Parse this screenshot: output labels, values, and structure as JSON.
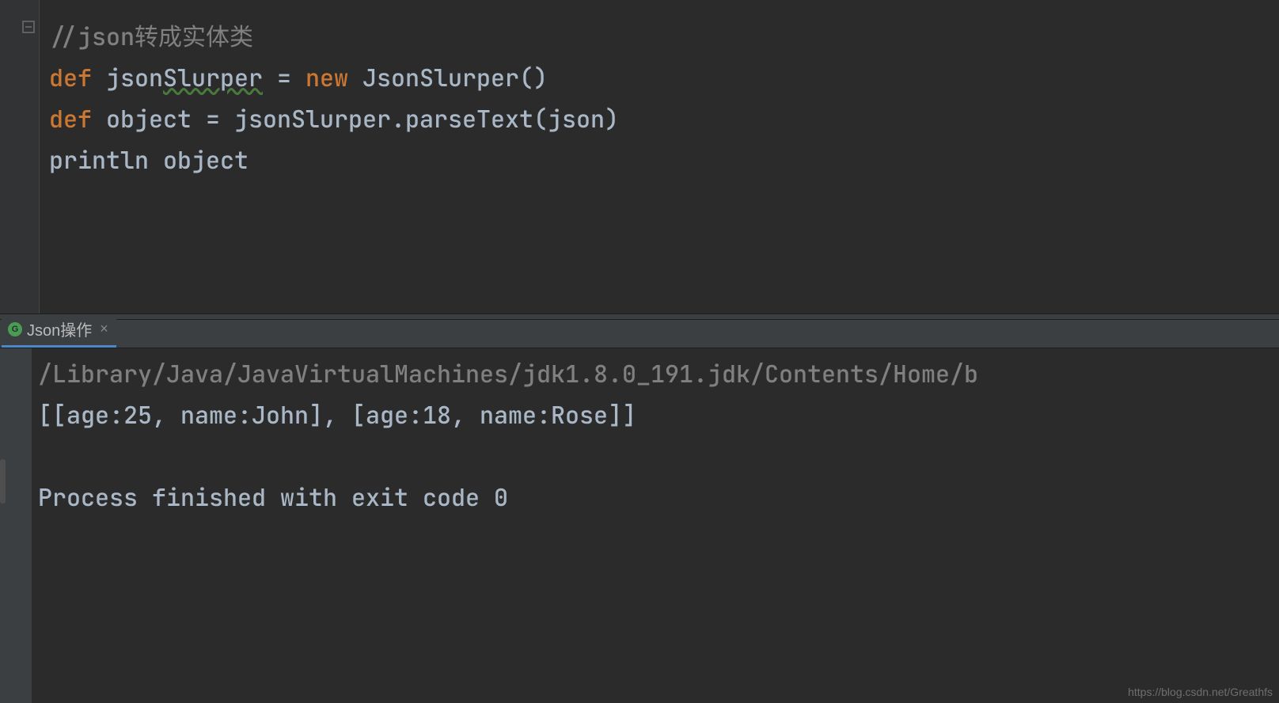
{
  "editor": {
    "comment": "//json转成实体类",
    "line2_def": "def",
    "line2_var": "json",
    "line2_slurper": "Slurper",
    "line2_eq": " = ",
    "line2_new": "new",
    "line2_call": " JsonSlurper()",
    "line3_def": "def",
    "line3_rest": " object = jsonSlurper.parseText(json)",
    "line4": "println object"
  },
  "tab": {
    "icon_letter": "G",
    "label": "Json操作",
    "close": "×"
  },
  "console": {
    "path": "/Library/Java/JavaVirtualMachines/jdk1.8.0_191.jdk/Contents/Home/b",
    "output_line": "[[age:25, name:John], [age:18, name:Rose]]",
    "blank": "",
    "exit_line": "Process finished with exit code 0"
  },
  "watermark": "https://blog.csdn.net/Greathfs"
}
